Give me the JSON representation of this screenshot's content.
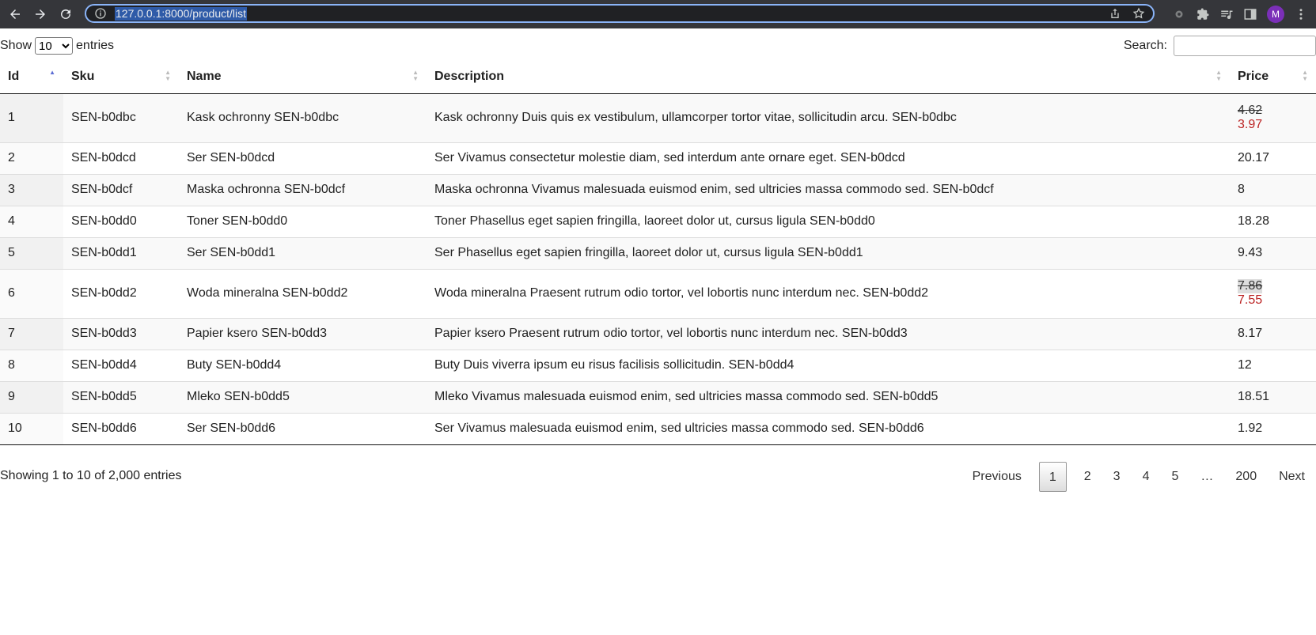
{
  "browser": {
    "url": "127.0.0.1:8000/product/list",
    "avatar_letter": "M"
  },
  "controls": {
    "show_label": "Show",
    "entries_label": "entries",
    "length_options": [
      "10"
    ],
    "search_label": "Search:",
    "search_value": ""
  },
  "table": {
    "columns": [
      "Id",
      "Sku",
      "Name",
      "Description",
      "Price"
    ],
    "rows": [
      {
        "id": "1",
        "sku": "SEN-b0dbc",
        "name": "Kask ochronny SEN-b0dbc",
        "description": "Kask ochronny Duis quis ex vestibulum, ullamcorper tortor vitae, sollicitudin arcu. SEN-b0dbc",
        "price_old": "4.62",
        "price": "3.97"
      },
      {
        "id": "2",
        "sku": "SEN-b0dcd",
        "name": "Ser SEN-b0dcd",
        "description": "Ser Vivamus consectetur molestie diam, sed interdum ante ornare eget. SEN-b0dcd",
        "price_old": "",
        "price": "20.17"
      },
      {
        "id": "3",
        "sku": "SEN-b0dcf",
        "name": "Maska ochronna SEN-b0dcf",
        "description": "Maska ochronna Vivamus malesuada euismod enim, sed ultricies massa commodo sed. SEN-b0dcf",
        "price_old": "",
        "price": "8"
      },
      {
        "id": "4",
        "sku": "SEN-b0dd0",
        "name": "Toner SEN-b0dd0",
        "description": "Toner Phasellus eget sapien fringilla, laoreet dolor ut, cursus ligula SEN-b0dd0",
        "price_old": "",
        "price": "18.28"
      },
      {
        "id": "5",
        "sku": "SEN-b0dd1",
        "name": "Ser SEN-b0dd1",
        "description": "Ser Phasellus eget sapien fringilla, laoreet dolor ut, cursus ligula SEN-b0dd1",
        "price_old": "",
        "price": "9.43"
      },
      {
        "id": "6",
        "sku": "SEN-b0dd2",
        "name": "Woda mineralna SEN-b0dd2",
        "description": "Woda mineralna Praesent rutrum odio tortor, vel lobortis nunc interdum nec. SEN-b0dd2",
        "price_old": "7.86",
        "price": "7.55"
      },
      {
        "id": "7",
        "sku": "SEN-b0dd3",
        "name": "Papier ksero SEN-b0dd3",
        "description": "Papier ksero Praesent rutrum odio tortor, vel lobortis nunc interdum nec. SEN-b0dd3",
        "price_old": "",
        "price": "8.17"
      },
      {
        "id": "8",
        "sku": "SEN-b0dd4",
        "name": "Buty SEN-b0dd4",
        "description": "Buty Duis viverra ipsum eu risus facilisis sollicitudin. SEN-b0dd4",
        "price_old": "",
        "price": "12"
      },
      {
        "id": "9",
        "sku": "SEN-b0dd5",
        "name": "Mleko SEN-b0dd5",
        "description": "Mleko Vivamus malesuada euismod enim, sed ultricies massa commodo sed. SEN-b0dd5",
        "price_old": "",
        "price": "18.51"
      },
      {
        "id": "10",
        "sku": "SEN-b0dd6",
        "name": "Ser SEN-b0dd6",
        "description": "Ser Vivamus malesuada euismod enim, sed ultricies massa commodo sed. SEN-b0dd6",
        "price_old": "",
        "price": "1.92"
      }
    ]
  },
  "footer": {
    "info": "Showing 1 to 10 of 2,000 entries",
    "previous": "Previous",
    "pages": [
      "1",
      "2",
      "3",
      "4",
      "5",
      "…",
      "200"
    ],
    "current_page": "1",
    "next": "Next"
  }
}
